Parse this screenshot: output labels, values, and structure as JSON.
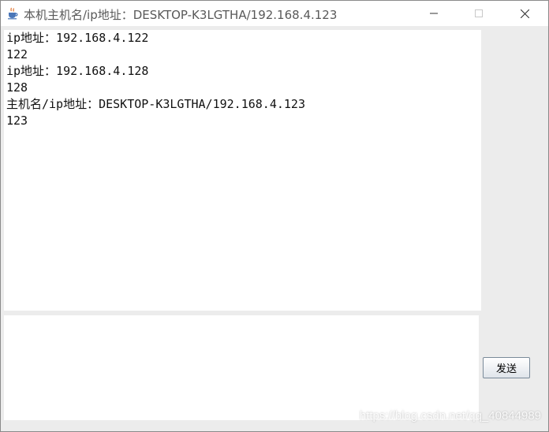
{
  "window": {
    "title": "本机主机名/ip地址：DESKTOP-K3LGTHA/192.168.4.123",
    "app_icon": "java-coffee-cup-icon"
  },
  "titlebar_buttons": {
    "minimize_icon": "minimize-icon",
    "maximize_icon": "maximize-icon",
    "close_icon": "close-icon"
  },
  "output": {
    "lines": [
      "ip地址：192.168.4.122",
      "122",
      "ip地址：192.168.4.128",
      "128",
      "主机名/ip地址：DESKTOP-K3LGTHA/192.168.4.123",
      "123"
    ]
  },
  "input": {
    "value": ""
  },
  "send_button": {
    "label": "发送"
  },
  "watermark": "https://blog.csdn.net/qq_40844989"
}
